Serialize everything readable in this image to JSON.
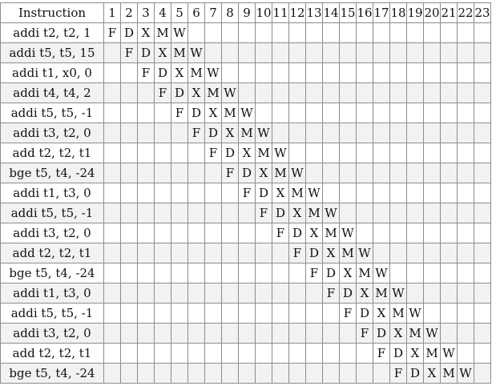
{
  "header": {
    "instruction_label": "Instruction",
    "cycles": [
      "1",
      "2",
      "3",
      "4",
      "5",
      "6",
      "7",
      "8",
      "9",
      "10",
      "11",
      "12",
      "13",
      "14",
      "15",
      "16",
      "17",
      "18",
      "19",
      "20",
      "21",
      "22",
      "23"
    ]
  },
  "stages": [
    "F",
    "D",
    "X",
    "M",
    "W"
  ],
  "rows": [
    {
      "instr": "addi t2, t2, 1",
      "start": 1
    },
    {
      "instr": "addi t5, t5, 15",
      "start": 2
    },
    {
      "instr": "addi t1, x0, 0",
      "start": 3
    },
    {
      "instr": "addi t4, t4, 2",
      "start": 4
    },
    {
      "instr": "addi t5, t5, -1",
      "start": 5
    },
    {
      "instr": "addi t3, t2, 0",
      "start": 6
    },
    {
      "instr": "add t2, t2, t1",
      "start": 7
    },
    {
      "instr": "bge t5, t4, -24",
      "start": 8
    },
    {
      "instr": "addi t1, t3, 0",
      "start": 9
    },
    {
      "instr": "addi t5, t5, -1",
      "start": 10
    },
    {
      "instr": "addi t3, t2, 0",
      "start": 11
    },
    {
      "instr": "add t2, t2, t1",
      "start": 12
    },
    {
      "instr": "bge t5, t4, -24",
      "start": 13
    },
    {
      "instr": "addi t1, t3, 0",
      "start": 14
    },
    {
      "instr": "addi t5, t5, -1",
      "start": 15
    },
    {
      "instr": "addi t3, t2, 0",
      "start": 16
    },
    {
      "instr": "add t2, t2, t1",
      "start": 17
    },
    {
      "instr": "bge t5, t4, -24",
      "start": 18
    }
  ]
}
